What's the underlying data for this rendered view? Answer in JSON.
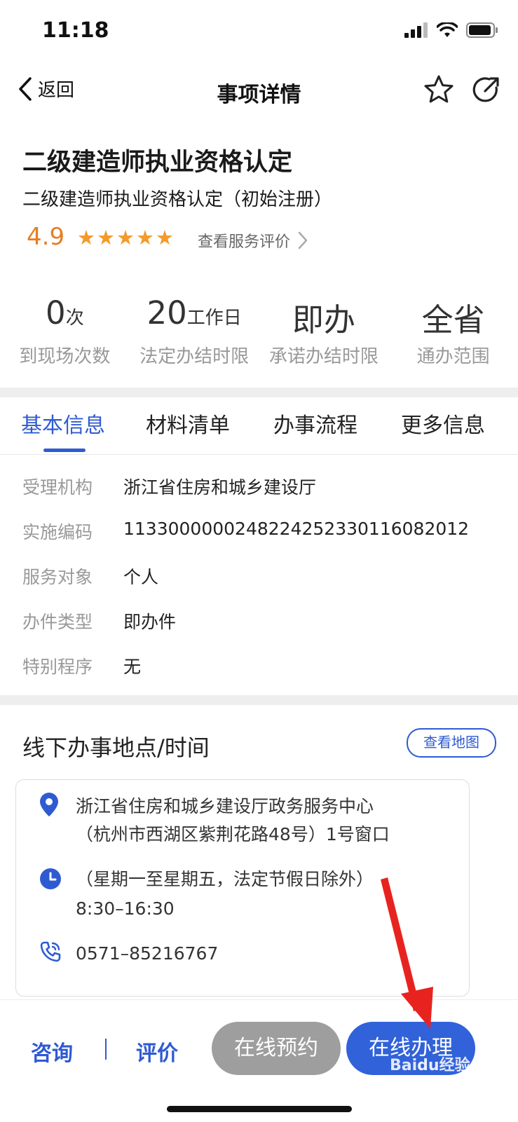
{
  "status_bar": {
    "time": "11:18"
  },
  "nav": {
    "back_label": "返回",
    "title": "事项详情"
  },
  "item": {
    "title": "二级建造师执业资格认定",
    "subtitle": "二级建造师执业资格认定（初始注册）",
    "rating": "4.9",
    "stars": 5,
    "review_link": "查看服务评价"
  },
  "stats": [
    {
      "value": "0",
      "unit": "次",
      "label": "到现场次数"
    },
    {
      "value": "20",
      "unit": "工作日",
      "label": "法定办结时限"
    },
    {
      "value": "即办",
      "unit": "",
      "label": "承诺办结时限"
    },
    {
      "value": "全省",
      "unit": "",
      "label": "通办范围"
    }
  ],
  "tabs": [
    {
      "label": "基本信息",
      "active": true
    },
    {
      "label": "材料清单",
      "active": false
    },
    {
      "label": "办事流程",
      "active": false
    },
    {
      "label": "更多信息",
      "active": false
    }
  ],
  "basic_info": [
    {
      "label": "受理机构",
      "value": "浙江省住房和城乡建设厅"
    },
    {
      "label": "实施编码",
      "value": "11330000002482242523301160820 12"
    },
    {
      "label": "服务对象",
      "value": "个人"
    },
    {
      "label": "办件类型",
      "value": "即办件"
    },
    {
      "label": "特别程序",
      "value": "无"
    }
  ],
  "offline": {
    "title": "线下办事地点/时间",
    "map_button": "查看地图",
    "address_line1": "浙江省住房和城乡建设厅政务服务中心",
    "address_line2": "（杭州市西湖区紫荆花路48号）1号窗口",
    "hours_line1": "（星期一至星期五，法定节假日除外）",
    "hours_line2": "8:30–16:30",
    "phone": "0571–85216767"
  },
  "bottom_bar": {
    "consult": "咨询",
    "evaluate": "评价",
    "reserve": "在线预约",
    "apply": "在线办理"
  },
  "colors": {
    "accent": "#2f5bd2",
    "rating": "#e67e22",
    "reserve_btn": "#9e9e9e",
    "apply_btn": "#3162d9",
    "arrow": "#e8231f"
  },
  "watermark": "Baidu经验 jingyan.baidu.com"
}
